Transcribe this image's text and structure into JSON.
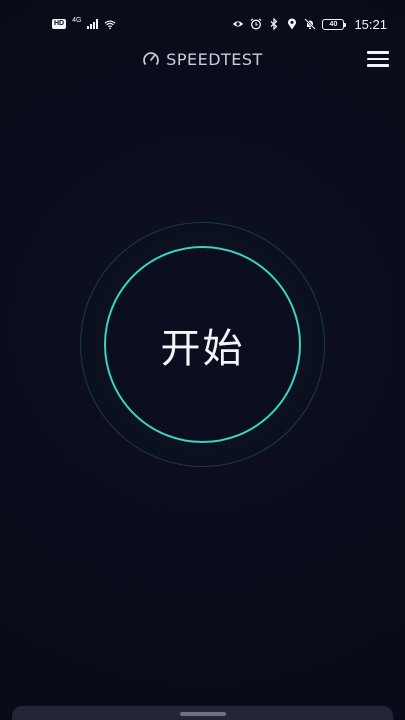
{
  "status_bar": {
    "hd_badge": "HD",
    "network_type": "4G",
    "battery_level": "40",
    "time": "15:21",
    "icons": [
      "hd-icon",
      "signal-icon",
      "wifi-icon",
      "eye-icon",
      "alarm-icon",
      "bluetooth-icon",
      "location-icon",
      "mute-icon",
      "battery-icon"
    ]
  },
  "header": {
    "logo_text": "SPEEDTEST",
    "logo_icon": "speedometer-icon",
    "menu_icon": "hamburger-menu-icon"
  },
  "main": {
    "start_label": "开始"
  },
  "colors": {
    "background": "#0a0c1b",
    "accent_ring": "#37d3c6",
    "outer_ring": "#1c3a44",
    "text": "#f3f5f9",
    "sheet": "#222636"
  }
}
